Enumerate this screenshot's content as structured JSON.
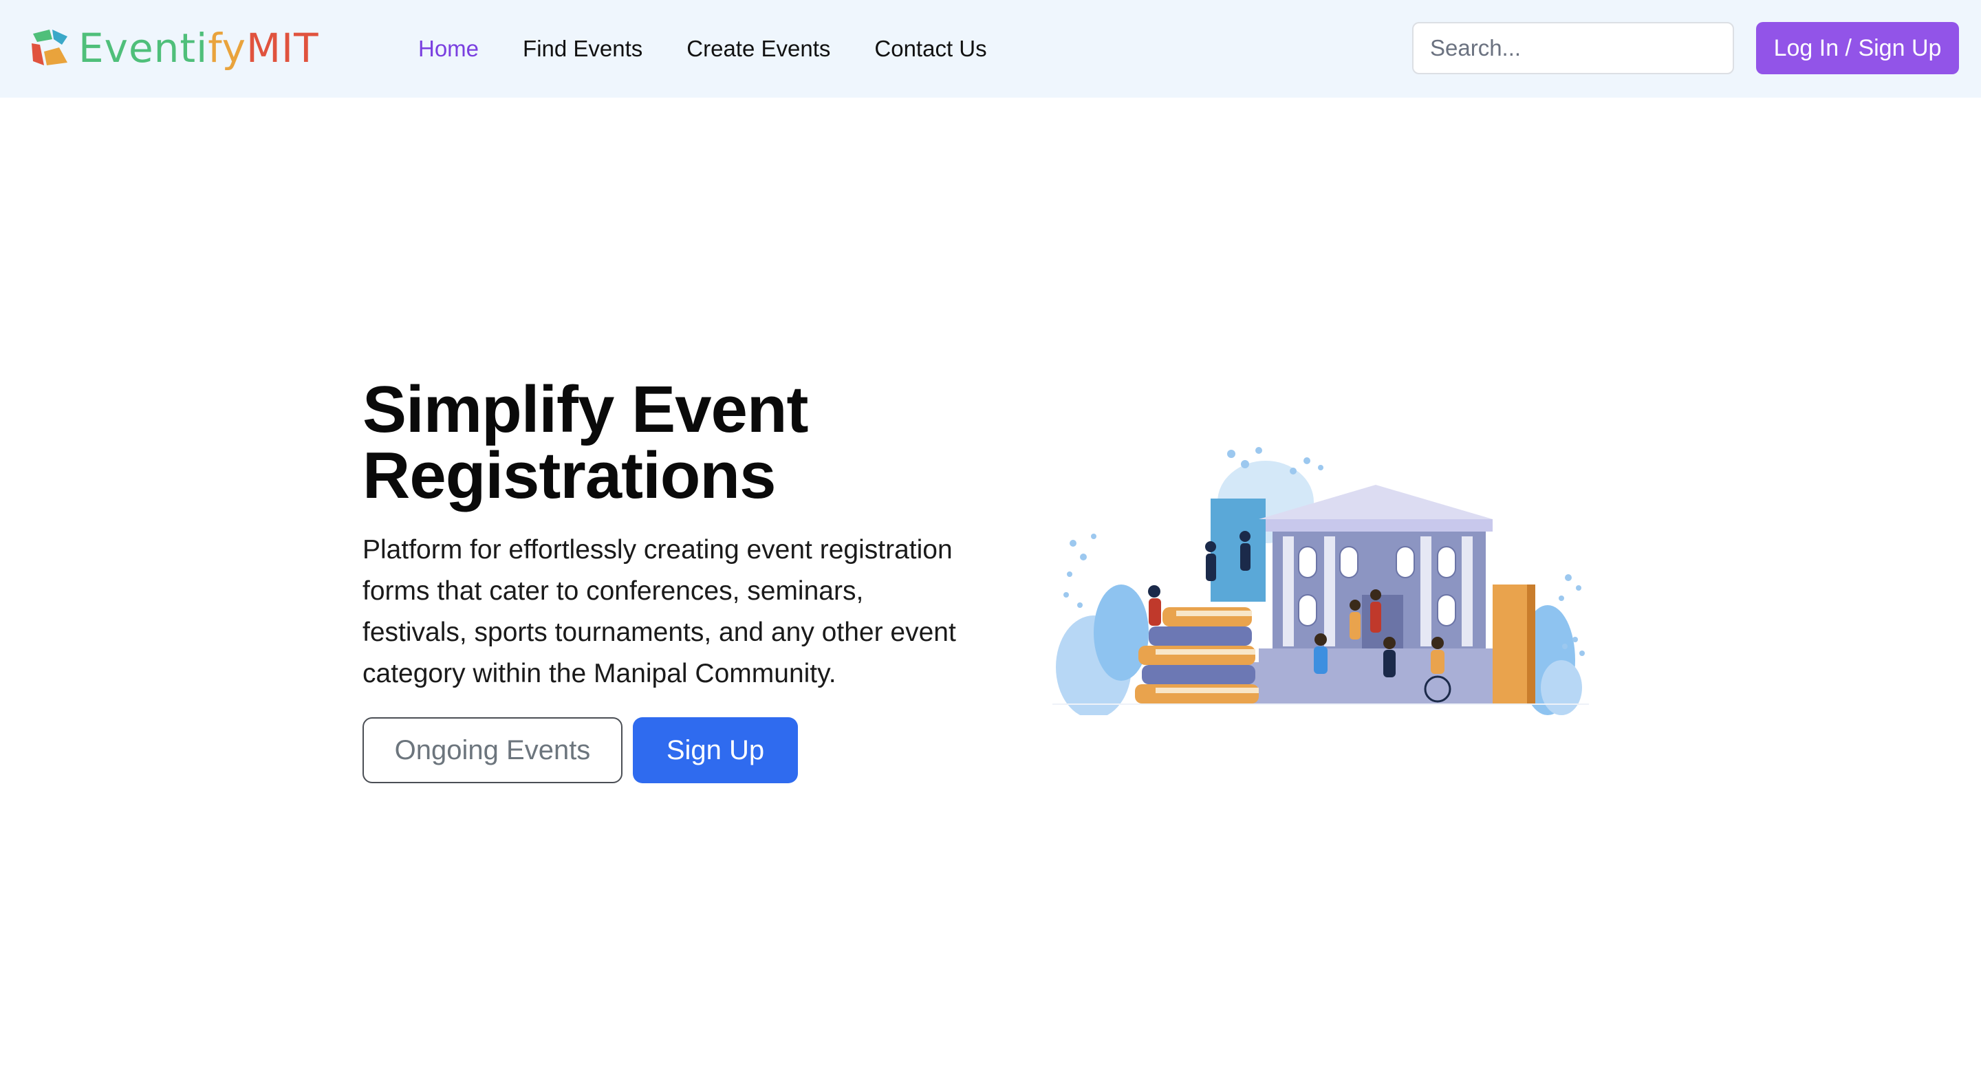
{
  "brand": {
    "logo_text_part1": "Eventi",
    "logo_text_part2": "fy",
    "logo_text_part3": "MIT",
    "icon": "eventify-logo-icon"
  },
  "nav": {
    "items": [
      {
        "label": "Home",
        "active": true
      },
      {
        "label": "Find Events",
        "active": false
      },
      {
        "label": "Create Events",
        "active": false
      },
      {
        "label": "Contact Us",
        "active": false
      }
    ]
  },
  "search": {
    "placeholder": "Search...",
    "value": ""
  },
  "auth": {
    "login_label": "Log In / Sign Up"
  },
  "hero": {
    "title": "Simplify Event Registrations",
    "description": "Platform for effortlessly creating event registration forms that cater to conferences, seminars, festivals, sports tournaments, and any other event category within the Manipal Community.",
    "secondary_button": "Ongoing Events",
    "primary_button": "Sign Up"
  },
  "colors": {
    "nav_background": "#eff6fd",
    "active_link": "#7a3fe0",
    "login_button": "#9254e8",
    "primary_button": "#2f6bef"
  }
}
